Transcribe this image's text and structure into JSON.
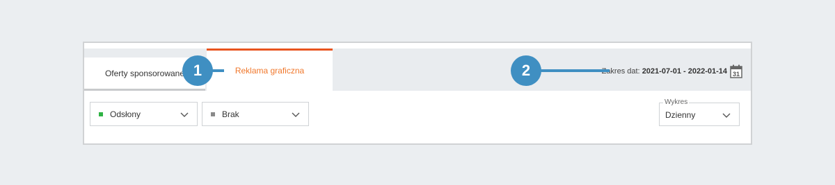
{
  "tabs": [
    {
      "label": "Oferty sponsorowane",
      "active": false
    },
    {
      "label": "Reklama graficzna",
      "active": true
    }
  ],
  "date_range": {
    "label": "Zakres dat:",
    "value": "2021-07-01 - 2022-01-14",
    "calendar_day": "31"
  },
  "metric_dropdowns": [
    {
      "label": "Odsłony",
      "swatch_color": "#2fb344"
    },
    {
      "label": "Brak",
      "swatch_color": "#8a8a8a"
    }
  ],
  "chart_select": {
    "legend": "Wykres",
    "value": "Dzienny"
  },
  "callouts": [
    {
      "number": "1"
    },
    {
      "number": "2"
    }
  ],
  "colors": {
    "accent": "#e8541e",
    "active_tab_text": "#f0772b",
    "callout": "#3f8fc2"
  }
}
